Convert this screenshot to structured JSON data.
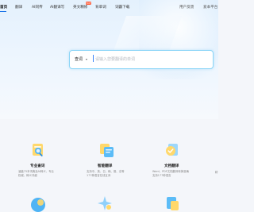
{
  "nav": {
    "items": [
      {
        "label": "首页",
        "active": true
      },
      {
        "label": "翻译"
      },
      {
        "label": "AI同传"
      },
      {
        "label": "AI翻译写"
      },
      {
        "label": "英文精修"
      },
      {
        "label": "背单词"
      },
      {
        "label": "词霸下载"
      }
    ],
    "badge": "HOT",
    "right": [
      "用户反馈",
      "爱本平台"
    ]
  },
  "search": {
    "type_label": "查词",
    "placeholder": "请输入您要翻译的单词"
  },
  "features": [
    {
      "title": "专业查词",
      "desc": "涵盖75本词典及AI释义，专业权威，释义详细",
      "icon": "book-search-icon"
    },
    {
      "title": "智能翻译",
      "desc": "支持中、英、日、韩、德、法等177种语言在线互译",
      "icon": "translate-doc-icon"
    },
    {
      "title": "文档翻译",
      "desc": "Word、PDF文档翻译转换准确支持177种语言",
      "icon": "document-translate-icon"
    }
  ],
  "partial_text": "精",
  "colors": {
    "accent": "#1a73e8",
    "hot": "#ff5a36",
    "search_border": "#8bd5f7"
  }
}
